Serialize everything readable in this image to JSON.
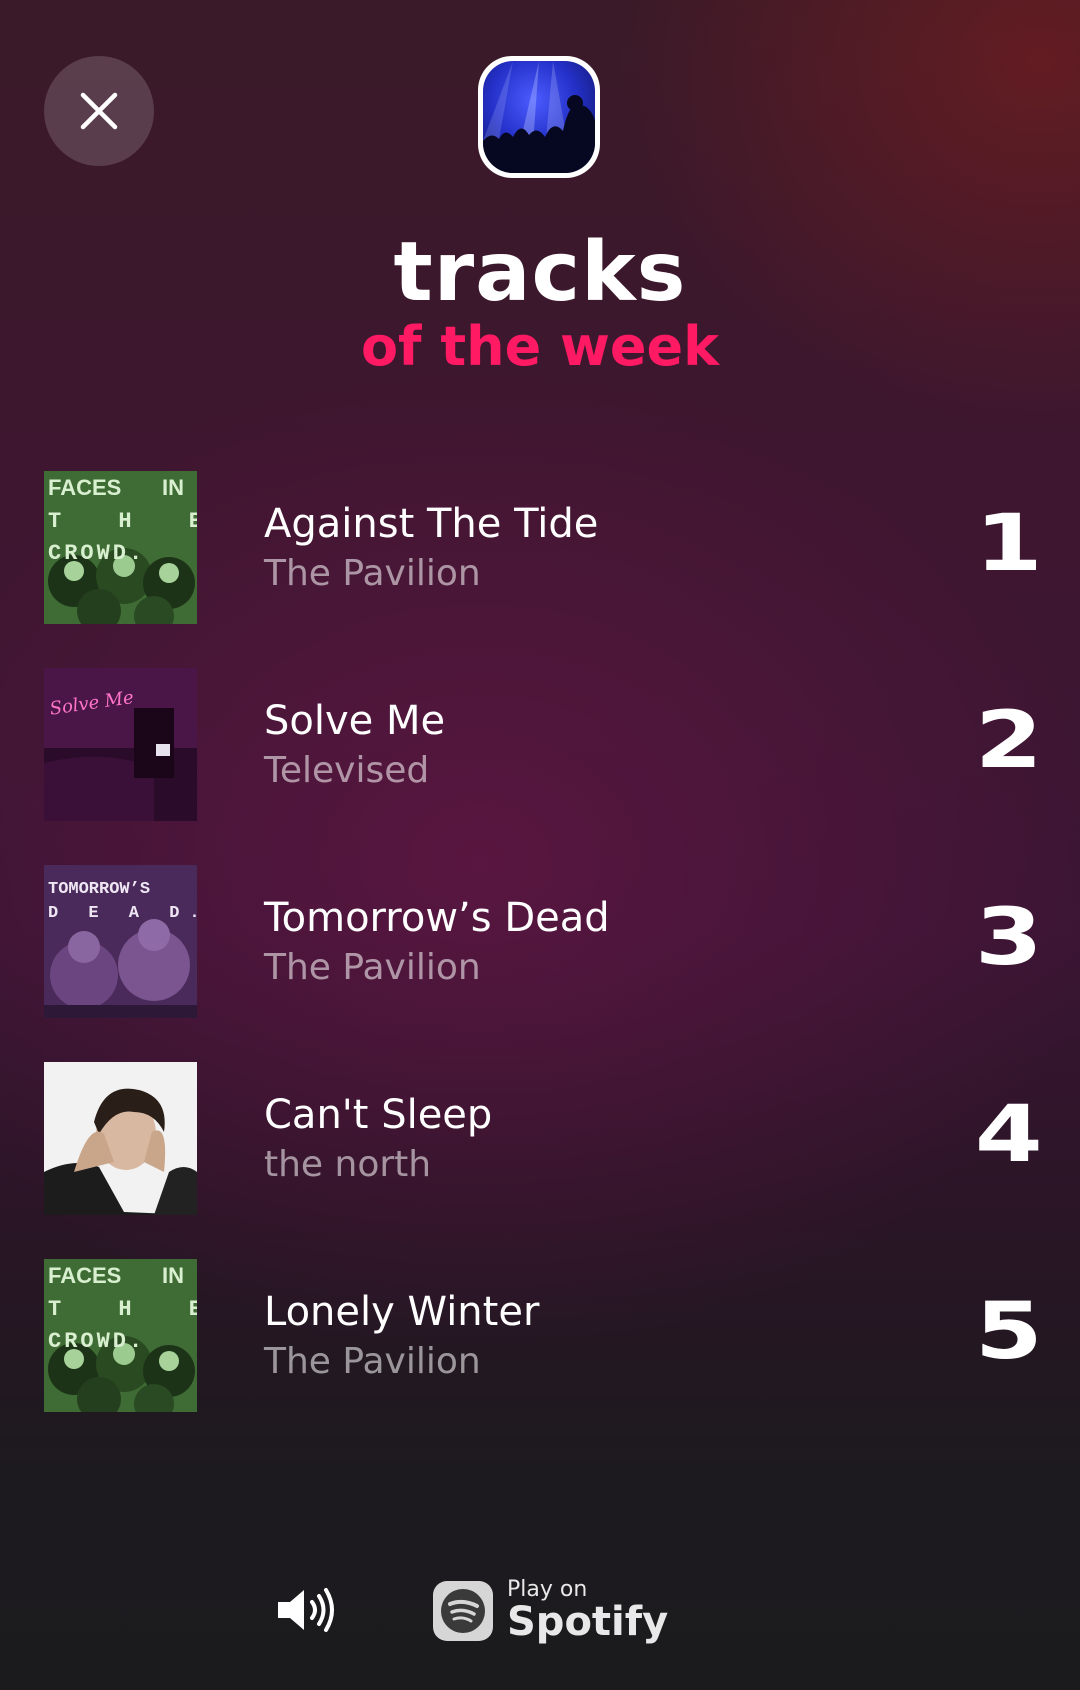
{
  "header": {
    "title": "tracks",
    "subtitle": "of the week"
  },
  "colors": {
    "accent": "#ff1a63",
    "text_primary": "#ffffff",
    "text_secondary": "#a997a2"
  },
  "tracks": [
    {
      "rank": "1",
      "title": "Against The Tide",
      "artist": "The Pavilion",
      "cover": "faces-in-the-crowd-cover"
    },
    {
      "rank": "2",
      "title": "Solve Me",
      "artist": "Televised",
      "cover": "solve-me-cover"
    },
    {
      "rank": "3",
      "title": "Tomorrow’s Dead",
      "artist": "The Pavilion",
      "cover": "tomorrows-dead-cover"
    },
    {
      "rank": "4",
      "title": "Can't Sleep",
      "artist": "the north",
      "cover": "cant-sleep-cover"
    },
    {
      "rank": "5",
      "title": "Lonely Winter",
      "artist": "The Pavilion",
      "cover": "faces-in-the-crowd-cover"
    }
  ],
  "covers": {
    "faces": {
      "line1a": "FACES",
      "line1b": "IN",
      "line2": "T H E",
      "line3": "CROWD."
    },
    "solve": {
      "text": "Solve Me"
    },
    "tomorrow": {
      "line1": "TOMORROW’S",
      "line2": "D E A D."
    }
  },
  "footer": {
    "play_on": "Play on",
    "service": "Spotify",
    "volume_icon": "speaker-volume-icon"
  }
}
